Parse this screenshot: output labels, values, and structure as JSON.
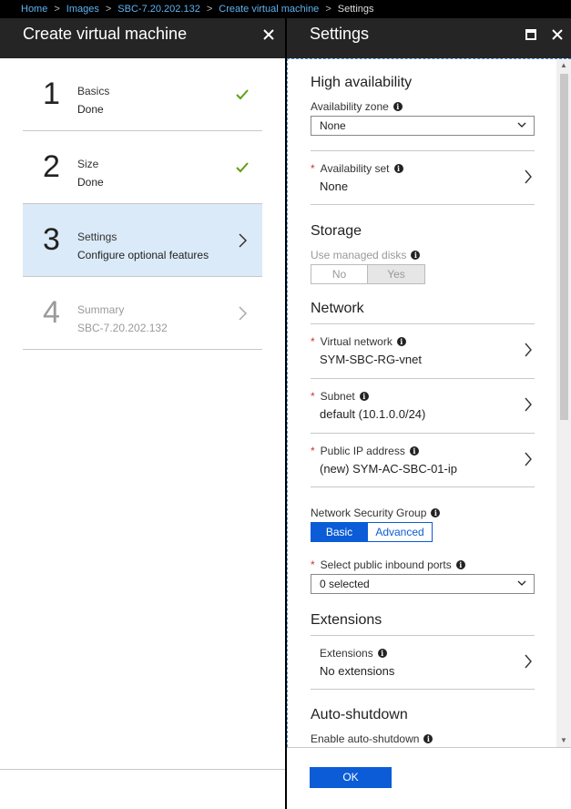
{
  "breadcrumb": {
    "items": [
      "Home",
      "Images",
      "SBC-7.20.202.132",
      "Create virtual machine"
    ],
    "current": "Settings"
  },
  "left_blade": {
    "title": "Create virtual machine",
    "close_icon": "close-icon",
    "steps": [
      {
        "number": "1",
        "title": "Basics",
        "subtitle": "Done",
        "state": "done"
      },
      {
        "number": "2",
        "title": "Size",
        "subtitle": "Done",
        "state": "done"
      },
      {
        "number": "3",
        "title": "Settings",
        "subtitle": "Configure optional features",
        "state": "active"
      },
      {
        "number": "4",
        "title": "Summary",
        "subtitle": "SBC-7.20.202.132",
        "state": "disabled"
      }
    ]
  },
  "right_blade": {
    "title": "Settings",
    "maximize_icon": "maximize-icon",
    "close_icon": "close-icon",
    "high_availability": {
      "title": "High availability",
      "zone_label": "Availability zone",
      "zone_value": "None",
      "set_label": "Availability set",
      "set_value": "None"
    },
    "storage": {
      "title": "Storage",
      "managed_label": "Use managed disks",
      "no": "No",
      "yes": "Yes"
    },
    "network": {
      "title": "Network",
      "vnet_label": "Virtual network",
      "vnet_value": "SYM-SBC-RG-vnet",
      "subnet_label": "Subnet",
      "subnet_value": "default (10.1.0.0/24)",
      "pip_label": "Public IP address",
      "pip_value": "(new) SYM-AC-SBC-01-ip",
      "nsg_label": "Network Security Group",
      "nsg_basic": "Basic",
      "nsg_advanced": "Advanced",
      "ports_label": "Select public inbound ports",
      "ports_value": "0 selected"
    },
    "extensions": {
      "title": "Extensions",
      "label": "Extensions",
      "value": "No extensions"
    },
    "auto_shutdown": {
      "title": "Auto-shutdown",
      "enable_label": "Enable auto-shutdown"
    },
    "ok_label": "OK"
  },
  "colors": {
    "accent": "#0b5cd6",
    "check": "#5ea010",
    "required": "#d13438",
    "active_step_bg": "#dbeaf8",
    "header_bg": "#252525"
  }
}
